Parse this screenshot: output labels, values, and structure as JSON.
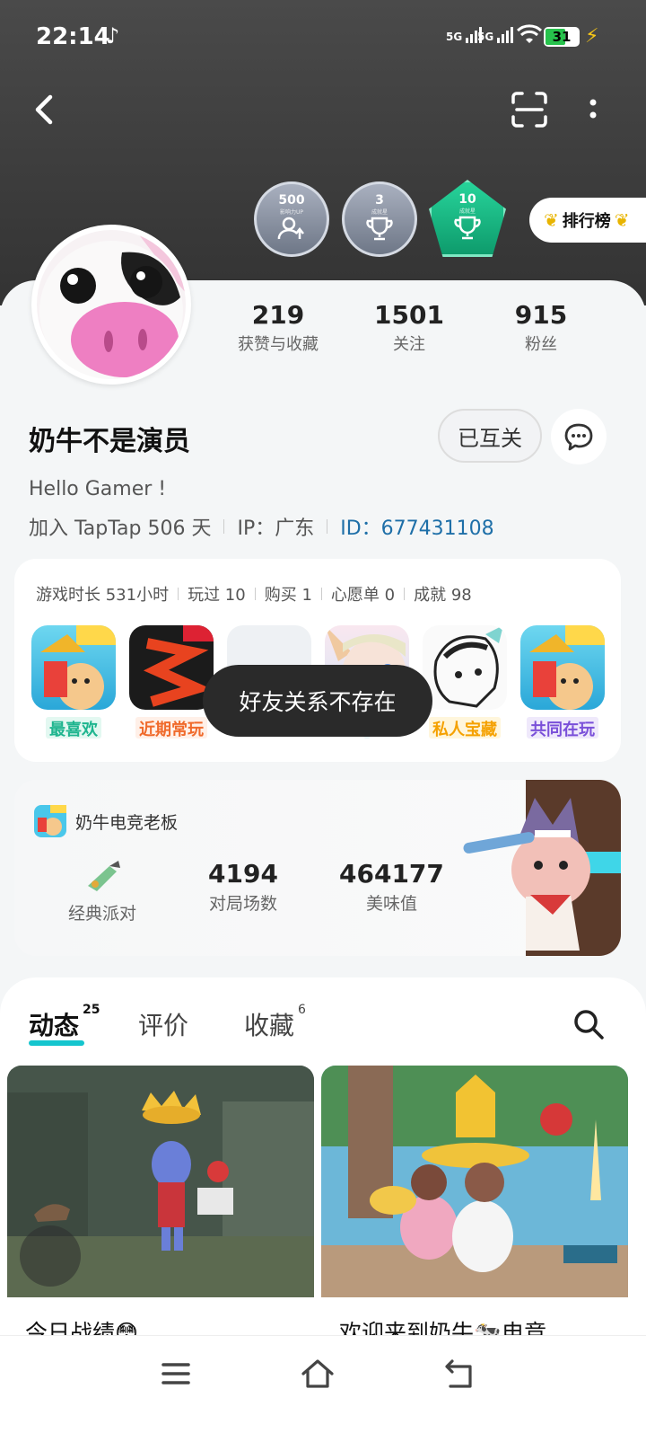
{
  "status_bar": {
    "time": "22:14",
    "network_1": "5G",
    "network_2": "5G",
    "battery": "31"
  },
  "badges": [
    {
      "value": "500",
      "sub": "影响力UP"
    },
    {
      "value": "3",
      "sub": "成就星"
    },
    {
      "value": "10",
      "sub": "成就星"
    }
  ],
  "rank_button": {
    "label": "排行榜"
  },
  "stats": [
    {
      "value": "219",
      "label": "获赞与收藏"
    },
    {
      "value": "1501",
      "label": "关注"
    },
    {
      "value": "915",
      "label": "粉丝"
    }
  ],
  "profile": {
    "username": "奶牛不是演员",
    "follow_state": "已互关",
    "bio": "Hello Gamer !",
    "joined": "加入 TapTap 506 天",
    "ip": "IP：广东",
    "id": "ID：677431108"
  },
  "game_summary": {
    "playtime": "游戏时长 531小时",
    "played": "玩过 10",
    "bought": "购买 1",
    "wishlist": "心愿单 0",
    "achievements": "成就 98"
  },
  "games": [
    {
      "label": "最喜欢",
      "label_color": "#1fb58f",
      "label_bg": "#e3f8f1"
    },
    {
      "label": "近期常玩",
      "label_color": "#f06a2b",
      "label_bg": "#fff0e8"
    },
    {
      "label": "",
      "label_color": "#999",
      "label_bg": "transparent"
    },
    {
      "label": "",
      "label_color": "#3a8de0",
      "label_bg": "#e6f1fc"
    },
    {
      "label": "私人宝藏",
      "label_color": "#f5a100",
      "label_bg": "#fff6dc"
    },
    {
      "label": "共同在玩",
      "label_color": "#7a50d9",
      "label_bg": "#efe9fb"
    }
  ],
  "toast": {
    "text": "好友关系不存在"
  },
  "party": {
    "title": "奶牛电竞老板",
    "mode_label": "经典派对",
    "matches_value": "4194",
    "matches_label": "对局场数",
    "score_value": "464177",
    "score_label": "美味值"
  },
  "tabs": [
    {
      "label": "动态",
      "count": "25"
    },
    {
      "label": "评价",
      "count": ""
    },
    {
      "label": "收藏",
      "count": "6"
    }
  ],
  "posts": [
    {
      "title": "今日战绩😳"
    },
    {
      "title": "欢迎来到奶牛🐄电竞"
    }
  ],
  "colors": {
    "accent": "#15c5ce",
    "id_link": "#1e6fa8"
  }
}
